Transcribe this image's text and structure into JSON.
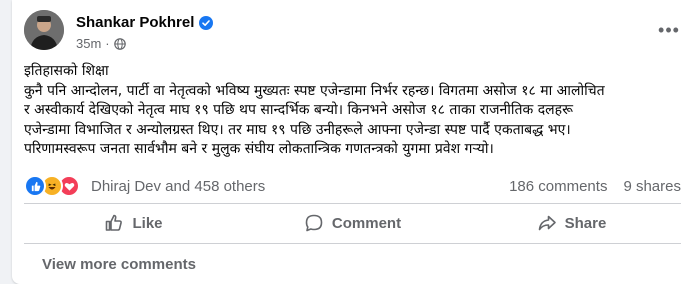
{
  "post": {
    "author": "Shankar Pokhrel",
    "time": "35m",
    "privacy_sep": "·",
    "more_glyph": "•••",
    "lines": [
      "इतिहासको शिक्षा",
      "कुनै पनि आन्दोलन, पार्टी वा नेतृत्वको भविष्य मुख्यतः स्पष्ट एजेन्डामा निर्भर रहन्छ। विगतमा असोज १८ मा आलोचित",
      "र अस्वीकार्य देखिएको नेतृत्व माघ १९ पछि थप सान्दर्भिक बन्यो। किनभने असोज १८ ताका राजनीतिक दलहरू",
      "एजेन्डामा विभाजित र अन्योलग्रस्त थिए। तर माघ १९ पछि उनीहरूले आफ्ना एजेन्डा स्पष्ट पार्दै एकताबद्ध भए।",
      "परिणामस्वरूप जनता सार्वभौम बने र मुलुक संघीय लोकतान्त्रिक गणतन्त्रको युगमा प्रवेश गर्‍यो।"
    ]
  },
  "stats": {
    "reactors": "Dhiraj Dev and 458 others",
    "comments": "186 comments",
    "shares": "9 shares"
  },
  "actions": {
    "like": "Like",
    "comment": "Comment",
    "share": "Share"
  },
  "view_more": "View more comments",
  "colors": {
    "accent": "#1877f2",
    "secondary_text": "#65676b",
    "like": "#1877f2",
    "haha": "#f7b125",
    "love": "#f33e58"
  },
  "icons": [
    "avatar",
    "verified-badge-icon",
    "globe-icon",
    "more-options-icon",
    "like-reaction-icon",
    "haha-reaction-icon",
    "love-reaction-icon",
    "thumbs-up-icon",
    "comment-icon",
    "share-icon"
  ]
}
